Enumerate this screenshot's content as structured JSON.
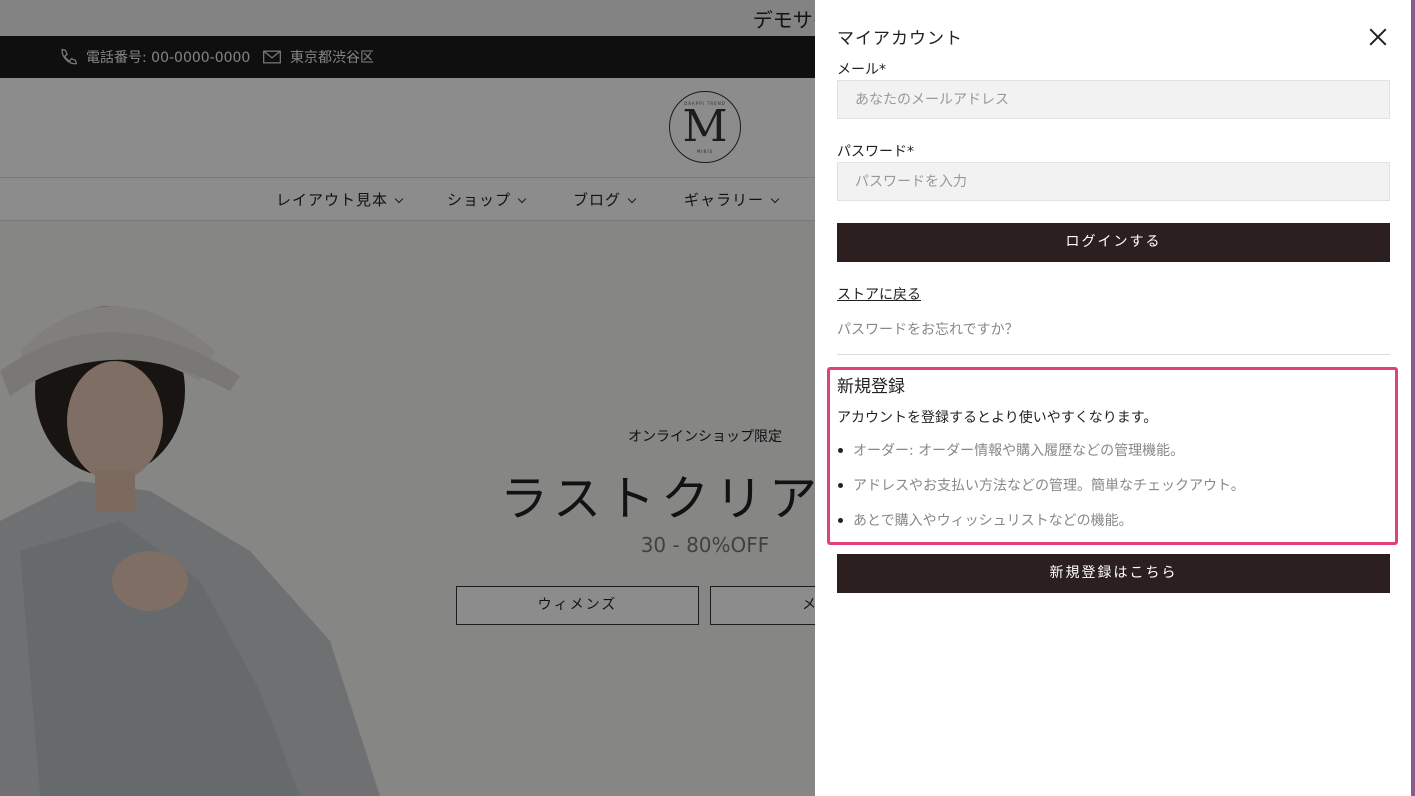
{
  "announcement": "デモサイト閲覧パス：「m」",
  "topbar": {
    "phone": "電話番号: 00-0000-0000",
    "address": "東京都渋谷区"
  },
  "logo": {
    "letter": "M",
    "top_text": "DRAPPI TREND",
    "bottom_text": "MINIS"
  },
  "nav": [
    {
      "label": "レイアウト見本"
    },
    {
      "label": "ショップ"
    },
    {
      "label": "ブログ"
    },
    {
      "label": "ギャラリー"
    }
  ],
  "hero": {
    "eyebrow": "オンラインショップ限定",
    "headline": "ラストクリアラ",
    "sub": "30 - 80%OFF",
    "button_women": "ウィメンズ",
    "button_men": "メ"
  },
  "drawer": {
    "title": "マイアカウント",
    "email_label": "メール*",
    "email_placeholder": "あなたのメールアドレス",
    "password_label": "パスワード*",
    "password_placeholder": "パスワードを入力",
    "login_button": "ログインする",
    "back_link": "ストアに戻る",
    "forgot_text": "パスワードをお忘れですか？",
    "register": {
      "title": "新規登録",
      "desc": "アカウントを登録するとより使いやすくなります。",
      "bullets": [
        "オーダー: オーダー情報や購入履歴などの管理機能。",
        "アドレスやお支払い方法などの管理。簡単なチェックアウト。",
        "あとで購入やウィッシュリストなどの機能。"
      ],
      "button": "新規登録はこちら"
    }
  },
  "colors": {
    "button_dark": "#2b1f1f",
    "highlight": "#e0417e",
    "topbar": "#1d1d1d",
    "drawer_edge": "#8e5a8a"
  }
}
